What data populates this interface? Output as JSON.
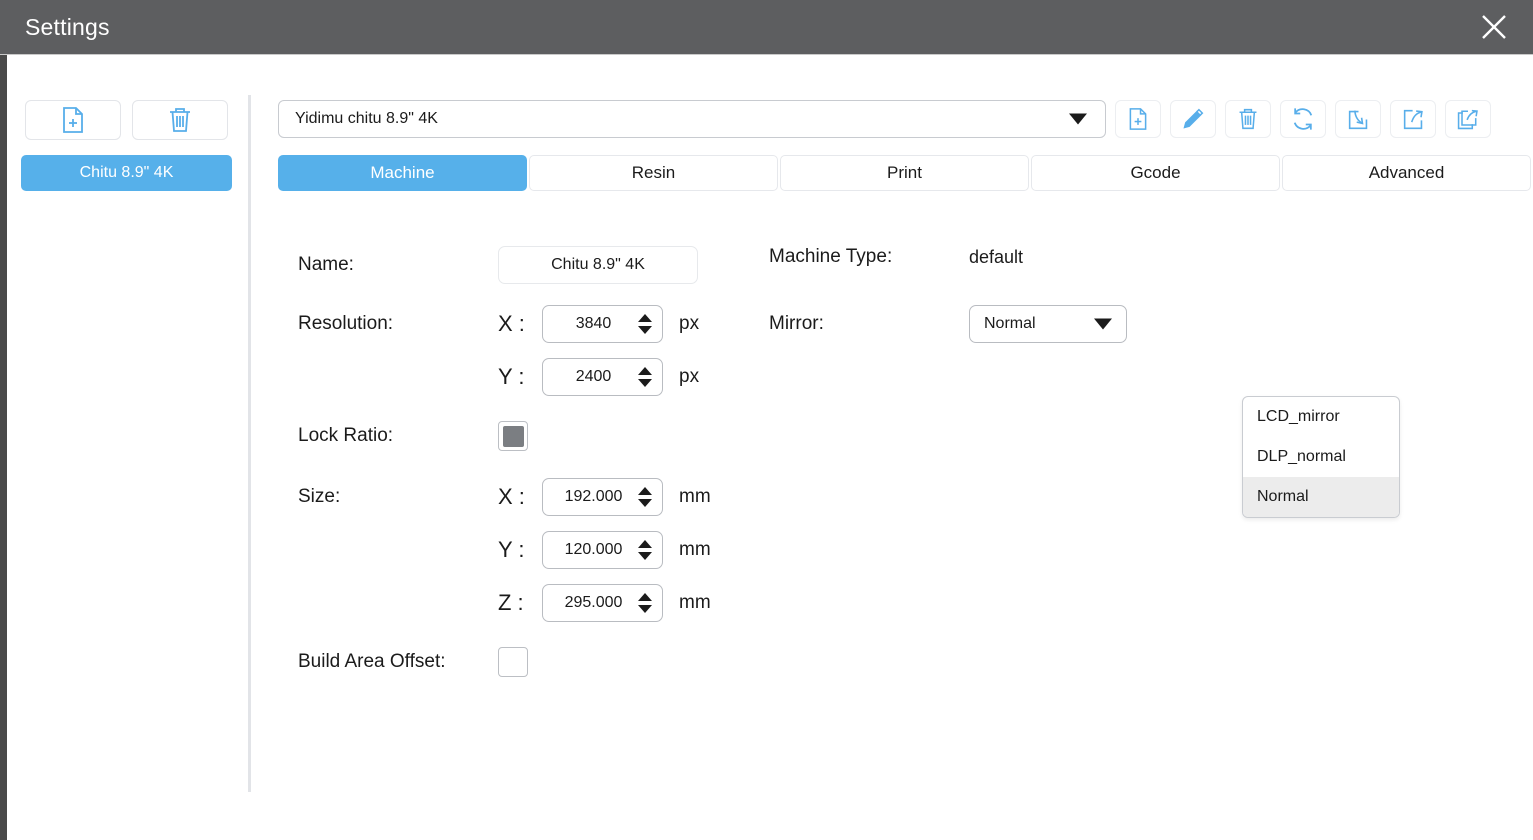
{
  "window": {
    "title": "Settings",
    "close_icon": "close-icon"
  },
  "sidebar": {
    "buttons": [
      {
        "name": "add-profile-button",
        "icon": "file-plus-icon"
      },
      {
        "name": "delete-profile-button",
        "icon": "trash-icon"
      }
    ],
    "items": [
      {
        "label": "Chitu 8.9\" 4K",
        "selected": true
      }
    ]
  },
  "toolbar": {
    "profile_select": {
      "value": "Yidimu chitu 8.9\" 4K",
      "caret_icon": "chevron-down-icon"
    },
    "buttons": [
      {
        "name": "new-button",
        "icon": "file-plus-icon"
      },
      {
        "name": "edit-button",
        "icon": "pencil-icon"
      },
      {
        "name": "delete-button",
        "icon": "trash-icon"
      },
      {
        "name": "refresh-button",
        "icon": "refresh-icon"
      },
      {
        "name": "import-button",
        "icon": "import-arrow-icon"
      },
      {
        "name": "export-button",
        "icon": "export-arrow-icon"
      },
      {
        "name": "export-all-button",
        "icon": "export-all-icon"
      }
    ]
  },
  "tabs": [
    {
      "label": "Machine",
      "active": true
    },
    {
      "label": "Resin",
      "active": false
    },
    {
      "label": "Print",
      "active": false
    },
    {
      "label": "Gcode",
      "active": false
    },
    {
      "label": "Advanced",
      "active": false
    }
  ],
  "machine": {
    "name": {
      "label": "Name:",
      "value": "Chitu 8.9\" 4K"
    },
    "resolution": {
      "label": "Resolution:",
      "x": {
        "axis": "X :",
        "value": "3840",
        "unit": "px"
      },
      "y": {
        "axis": "Y :",
        "value": "2400",
        "unit": "px"
      }
    },
    "lock_ratio": {
      "label": "Lock Ratio:",
      "checked": true
    },
    "size": {
      "label": "Size:",
      "x": {
        "axis": "X :",
        "value": "192.000",
        "unit": "mm"
      },
      "y": {
        "axis": "Y :",
        "value": "120.000",
        "unit": "mm"
      },
      "z": {
        "axis": "Z :",
        "value": "295.000",
        "unit": "mm"
      }
    },
    "build_area_offset": {
      "label": "Build Area Offset:",
      "checked": false
    },
    "machine_type": {
      "label": "Machine Type:",
      "value": "default"
    },
    "mirror": {
      "label": "Mirror:",
      "value": "Normal",
      "open": true,
      "options": [
        {
          "label": "LCD_mirror",
          "selected": false
        },
        {
          "label": "DLP_normal",
          "selected": false
        },
        {
          "label": "Normal",
          "selected": true
        }
      ]
    }
  },
  "colors": {
    "titlebar": "#5d5e60",
    "accent": "#56b0ea",
    "icon_blue": "#58aeea",
    "text": "#1b1b1b"
  }
}
